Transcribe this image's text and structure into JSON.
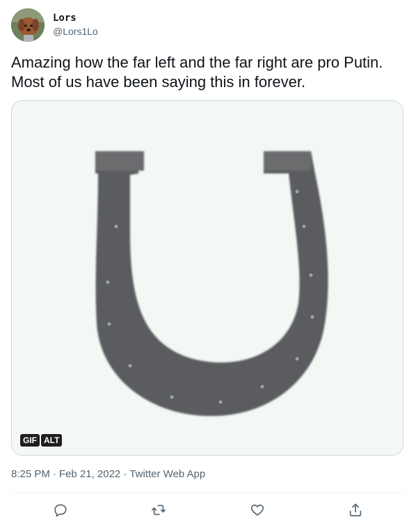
{
  "author": {
    "display_name": "Lors",
    "handle": "@Lors1Lo",
    "avatar_icon": "dog-photo-avatar"
  },
  "tweet": {
    "text_line1": "Amazing how the far left and the far right are pro Putin.",
    "text_line2": "Most of us have been saying this in forever."
  },
  "media": {
    "image_icon": "horseshoe-gif",
    "badge_gif": "GIF",
    "badge_alt": "ALT"
  },
  "meta": {
    "time": "8:25 PM",
    "sep1": "·",
    "date": "Feb 21, 2022",
    "sep2": "·",
    "source": "Twitter Web App"
  },
  "actions": [
    {
      "icon": "reply-icon"
    },
    {
      "icon": "retweet-icon"
    },
    {
      "icon": "like-icon"
    },
    {
      "icon": "share-icon"
    }
  ],
  "colors": {
    "text": "#0f1419",
    "secondary": "#536471",
    "border": "#cfd9de",
    "horseshoe": "#5a5c5e"
  }
}
